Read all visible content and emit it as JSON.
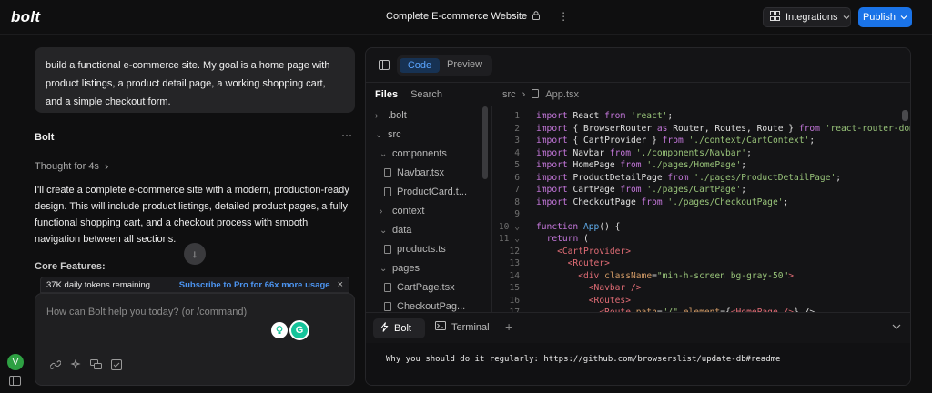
{
  "app": {
    "logo": "bolt"
  },
  "header": {
    "project_title": "Complete E-commerce Website",
    "lock_glyph": "🔒",
    "more_glyph": "⋮",
    "integrations_label": "Integrations",
    "publish_label": "Publish"
  },
  "chat": {
    "user_message": "build a functional e-commerce site. My goal is a home page with product listings, a product detail page, a working shopping cart, and a simple checkout form.",
    "assistant_name": "Bolt",
    "assistant_more": "···",
    "thought_label": "Thought for 4s",
    "thought_chevron": "›",
    "reply": "I'll create a complete e-commerce site with a modern, production-ready design. This will include product listings, detailed product pages, a fully functional shopping cart, and a checkout process with smooth navigation between all sections.",
    "core_features": "Core Features:",
    "scroll_glyph": "↓",
    "tokens_remaining": "37K daily tokens remaining.",
    "subscribe_link": "Subscribe to Pro for 66x more usage",
    "close_glyph": "×",
    "input_placeholder": "How can Bolt help you today? (or /command)",
    "grammarly_badge": "G",
    "avatar_letter": "V"
  },
  "workbench": {
    "tabs": {
      "code": "Code",
      "preview": "Preview"
    },
    "tree_tabs": {
      "files": "Files",
      "search": "Search"
    },
    "breadcrumb": {
      "folder": "src",
      "sep": "›",
      "file": "App.tsx"
    },
    "file_tree": [
      {
        "label": ".bolt",
        "kind": "folder",
        "indent": 0
      },
      {
        "label": "src",
        "kind": "folder-open",
        "indent": 0
      },
      {
        "label": "components",
        "kind": "folder-open",
        "indent": 1
      },
      {
        "label": "Navbar.tsx",
        "kind": "file",
        "indent": 2
      },
      {
        "label": "ProductCard.t...",
        "kind": "file",
        "indent": 2
      },
      {
        "label": "context",
        "kind": "folder",
        "indent": 1
      },
      {
        "label": "data",
        "kind": "folder-open",
        "indent": 1
      },
      {
        "label": "products.ts",
        "kind": "file",
        "indent": 2
      },
      {
        "label": "pages",
        "kind": "folder-open",
        "indent": 1
      },
      {
        "label": "CartPage.tsx",
        "kind": "file",
        "indent": 2
      },
      {
        "label": "CheckoutPag...",
        "kind": "file",
        "indent": 2
      }
    ],
    "code_lines": [
      [
        [
          "kw",
          "import "
        ],
        [
          "cur",
          "React "
        ],
        [
          "kw",
          "from "
        ],
        [
          "str",
          "'react'"
        ],
        [
          "cur",
          ";"
        ]
      ],
      [
        [
          "kw",
          "import "
        ],
        [
          "cur",
          "{ BrowserRouter "
        ],
        [
          "kw",
          "as "
        ],
        [
          "cur",
          "Router, Routes, Route } "
        ],
        [
          "kw",
          "from "
        ],
        [
          "str",
          "'react-router-dom'"
        ],
        [
          "cur",
          ";"
        ]
      ],
      [
        [
          "kw",
          "import "
        ],
        [
          "cur",
          "{ CartProvider } "
        ],
        [
          "kw",
          "from "
        ],
        [
          "str",
          "'./context/CartContext'"
        ],
        [
          "cur",
          ";"
        ]
      ],
      [
        [
          "kw",
          "import "
        ],
        [
          "cur",
          "Navbar "
        ],
        [
          "kw",
          "from "
        ],
        [
          "str",
          "'./components/Navbar'"
        ],
        [
          "cur",
          ";"
        ]
      ],
      [
        [
          "kw",
          "import "
        ],
        [
          "cur",
          "HomePage "
        ],
        [
          "kw",
          "from "
        ],
        [
          "str",
          "'./pages/HomePage'"
        ],
        [
          "cur",
          ";"
        ]
      ],
      [
        [
          "kw",
          "import "
        ],
        [
          "cur",
          "ProductDetailPage "
        ],
        [
          "kw",
          "from "
        ],
        [
          "str",
          "'./pages/ProductDetailPage'"
        ],
        [
          "cur",
          ";"
        ]
      ],
      [
        [
          "kw",
          "import "
        ],
        [
          "cur",
          "CartPage "
        ],
        [
          "kw",
          "from "
        ],
        [
          "str",
          "'./pages/CartPage'"
        ],
        [
          "cur",
          ";"
        ]
      ],
      [
        [
          "kw",
          "import "
        ],
        [
          "cur",
          "CheckoutPage "
        ],
        [
          "kw",
          "from "
        ],
        [
          "str",
          "'./pages/CheckoutPage'"
        ],
        [
          "cur",
          ";"
        ]
      ],
      [
        [
          "cur",
          ""
        ]
      ],
      [
        [
          "kw",
          "function "
        ],
        [
          "fn",
          "App"
        ],
        [
          "cur",
          "() {"
        ]
      ],
      [
        [
          "cur",
          "  "
        ],
        [
          "kw",
          "return "
        ],
        [
          "cur",
          "("
        ]
      ],
      [
        [
          "cur",
          "    "
        ],
        [
          "tag",
          "<CartProvider>"
        ]
      ],
      [
        [
          "cur",
          "      "
        ],
        [
          "tag",
          "<Router>"
        ]
      ],
      [
        [
          "cur",
          "        "
        ],
        [
          "tag",
          "<div "
        ],
        [
          "attr",
          "className"
        ],
        [
          "cur",
          "="
        ],
        [
          "str",
          "\"min-h-screen bg-gray-50\""
        ],
        [
          "tag",
          ">"
        ]
      ],
      [
        [
          "cur",
          "          "
        ],
        [
          "tag",
          "<Navbar />"
        ]
      ],
      [
        [
          "cur",
          "          "
        ],
        [
          "tag",
          "<Routes>"
        ]
      ],
      [
        [
          "cur",
          "            "
        ],
        [
          "tag",
          "<Route "
        ],
        [
          "attr",
          "path"
        ],
        [
          "cur",
          "="
        ],
        [
          "str",
          "\"/\" "
        ],
        [
          "attr",
          "element"
        ],
        [
          "cur",
          "={"
        ],
        [
          "tag",
          "<HomePage />"
        ],
        [
          "cur",
          "} />"
        ]
      ]
    ],
    "terminal_tabs": {
      "bolt": "Bolt",
      "terminal": "Terminal",
      "add": "+",
      "collapse": "⌄"
    },
    "terminal_output": "Why you should do it regularly: https://github.com/browserslist/update-db#readme"
  }
}
